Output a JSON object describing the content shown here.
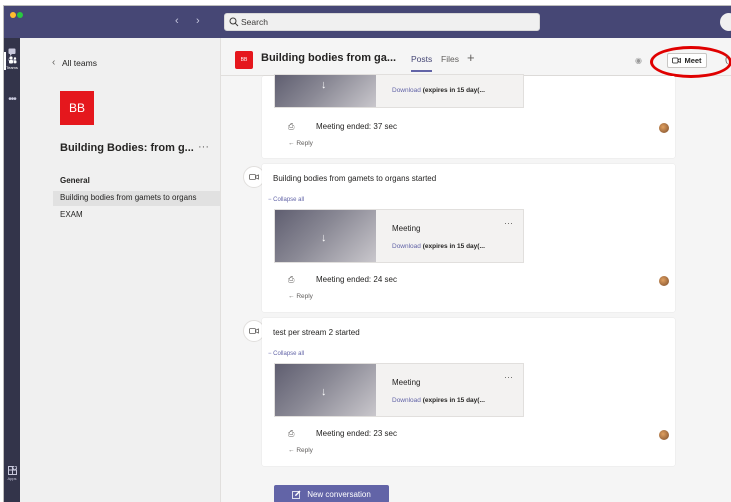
{
  "search": {
    "placeholder": "Search"
  },
  "rail": {
    "items": [
      {
        "label": "Chat",
        "icon": "chat-icon"
      },
      {
        "label": "Teams",
        "icon": "teams-icon"
      },
      {
        "label": "Apps",
        "icon": "apps-icon"
      }
    ]
  },
  "sidebar": {
    "back_label": "All teams",
    "team_initials": "BB",
    "team_name": "Building Bodies: from g...",
    "more": "···",
    "channels": [
      {
        "label": "General"
      },
      {
        "label": "Building bodies from gamets to organs"
      },
      {
        "label": "EXAM"
      }
    ]
  },
  "header": {
    "badge": "BB",
    "title": "Building bodies from ga...",
    "tabs": [
      "Posts",
      "Files"
    ],
    "add": "+",
    "meet_label": "Meet"
  },
  "posts": [
    {
      "download": "Download",
      "expires": "(expires in 15 day(...",
      "ended": "Meeting ended: 37 sec",
      "reply": "Reply"
    },
    {
      "title": "Building bodies from gamets to organs started",
      "collapse": "Collapse all",
      "meeting": "Meeting",
      "more": "···",
      "download": "Download",
      "expires": "(expires in 15 day(...",
      "ended": "Meeting ended: 24 sec",
      "reply": "Reply"
    },
    {
      "title": "test per stream 2 started",
      "collapse": "Collapse all",
      "meeting": "Meeting",
      "more": "···",
      "download": "Download",
      "expires": "(expires in 15 day(...",
      "ended": "Meeting ended: 23 sec",
      "reply": "Reply"
    }
  ],
  "new_conversation": "New conversation",
  "colors": {
    "brand": "#6264a7",
    "team_red": "#e5171d",
    "titlebar": "#464775",
    "highlight": "#e00000"
  }
}
